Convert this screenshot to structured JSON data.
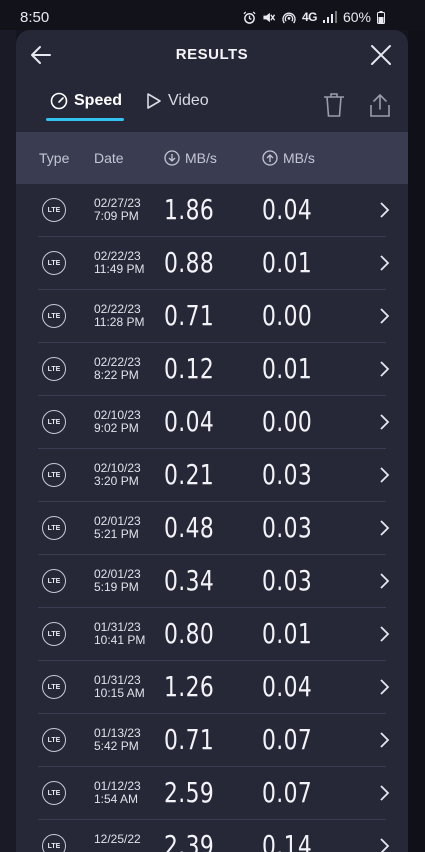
{
  "status_bar": {
    "time": "8:50",
    "network": "4G",
    "battery": "60%"
  },
  "header": {
    "title": "RESULTS"
  },
  "tabs": [
    {
      "label": "Speed",
      "active": true
    },
    {
      "label": "Video",
      "active": false
    }
  ],
  "columns": {
    "type": "Type",
    "date": "Date",
    "download": "MB/s",
    "upload": "MB/s"
  },
  "colors": {
    "accent": "#33c3f0",
    "sheet_bg": "#262837",
    "header_bg": "#3a3d52"
  },
  "rows": [
    {
      "type": "LTE",
      "date": "02/27/23",
      "time": "7:09 PM",
      "download": "1.86",
      "upload": "0.04"
    },
    {
      "type": "LTE",
      "date": "02/22/23",
      "time": "11:49 PM",
      "download": "0.88",
      "upload": "0.01"
    },
    {
      "type": "LTE",
      "date": "02/22/23",
      "time": "11:28 PM",
      "download": "0.71",
      "upload": "0.00"
    },
    {
      "type": "LTE",
      "date": "02/22/23",
      "time": "8:22 PM",
      "download": "0.12",
      "upload": "0.01"
    },
    {
      "type": "LTE",
      "date": "02/10/23",
      "time": "9:02 PM",
      "download": "0.04",
      "upload": "0.00"
    },
    {
      "type": "LTE",
      "date": "02/10/23",
      "time": "3:20 PM",
      "download": "0.21",
      "upload": "0.03"
    },
    {
      "type": "LTE",
      "date": "02/01/23",
      "time": "5:21 PM",
      "download": "0.48",
      "upload": "0.03"
    },
    {
      "type": "LTE",
      "date": "02/01/23",
      "time": "5:19 PM",
      "download": "0.34",
      "upload": "0.03"
    },
    {
      "type": "LTE",
      "date": "01/31/23",
      "time": "10:41 PM",
      "download": "0.80",
      "upload": "0.01"
    },
    {
      "type": "LTE",
      "date": "01/31/23",
      "time": "10:15 AM",
      "download": "1.26",
      "upload": "0.04"
    },
    {
      "type": "LTE",
      "date": "01/13/23",
      "time": "5:42 PM",
      "download": "0.71",
      "upload": "0.07"
    },
    {
      "type": "LTE",
      "date": "01/12/23",
      "time": "1:54 AM",
      "download": "2.59",
      "upload": "0.07"
    },
    {
      "type": "LTE",
      "date": "12/25/22",
      "time": "",
      "download": "2.39",
      "upload": "0.14"
    }
  ]
}
